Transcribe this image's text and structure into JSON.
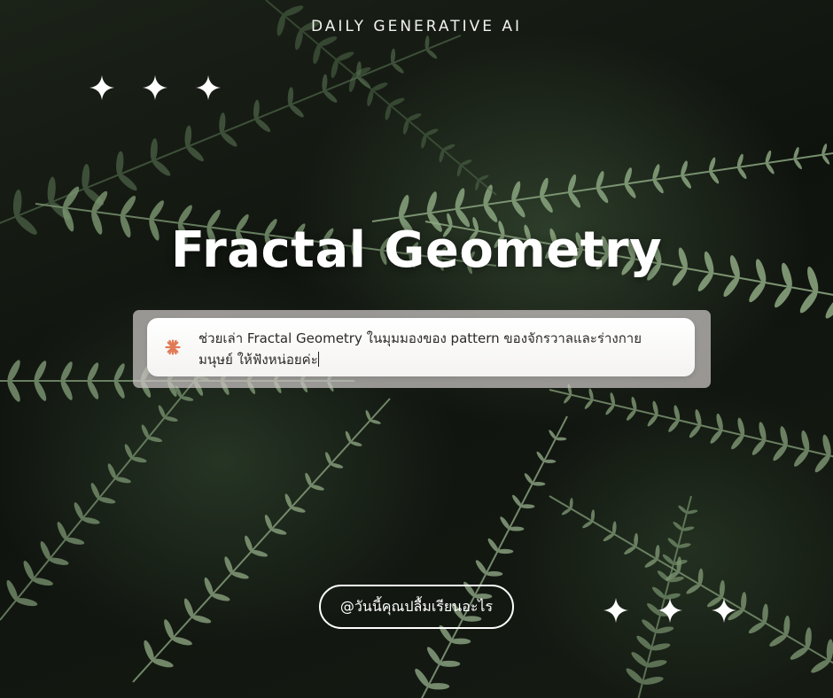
{
  "brand": {
    "label": "DAILY GENERATIVE AI"
  },
  "title": {
    "text": "Fractal Geometry"
  },
  "prompt": {
    "line1": "ช่วยเล่า Fractal Geometry ในมุมมองของ pattern ของจักรวาลและร่างกาย",
    "line2": "มนุษย์ ให้ฟังหน่อยค่ะ",
    "icon": "sparkle-icon"
  },
  "handle": {
    "text": "@วันนี้คุณปลื้มเรียนอะไร"
  },
  "decor": {
    "star_icon": "four-point-star-icon",
    "background": "fern-leaves-photo"
  },
  "colors": {
    "accent": "#e07a55",
    "text": "#ffffff"
  }
}
